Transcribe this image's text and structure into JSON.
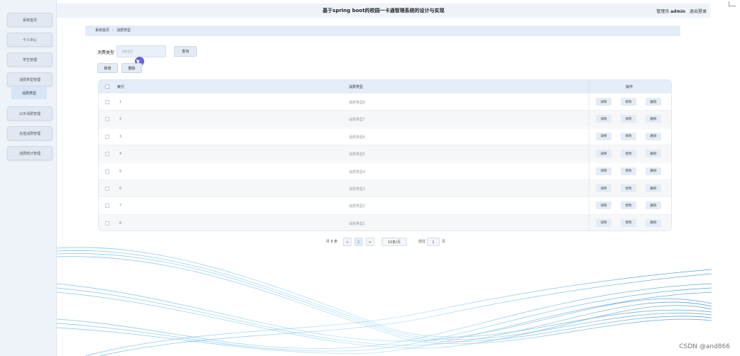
{
  "sidebar": {
    "items": [
      {
        "label": "系统首页"
      },
      {
        "label": "个人中心"
      },
      {
        "label": "学生管理"
      },
      {
        "label": "消费类型管理"
      },
      {
        "label": "公示消费管理"
      },
      {
        "label": "充值消费管理"
      },
      {
        "label": "消费统计管理"
      }
    ],
    "sub_item": "消费类型"
  },
  "header": {
    "title": "基于spring boot的校园一卡通管理系统的设计与实现",
    "role": "管理员",
    "username": "admin",
    "logout": "退出登录"
  },
  "breadcrumb": {
    "home": "系统首页",
    "separator": "›",
    "current": "消费类型"
  },
  "search": {
    "label": "消费类型",
    "placeholder": "消费类型",
    "button": "查询"
  },
  "actions": {
    "add": "新增",
    "delete": "删除"
  },
  "table": {
    "headers": {
      "index": "索引",
      "type": "消费类型",
      "ops": "操作"
    },
    "op_labels": {
      "detail": "详情",
      "edit": "修改",
      "delete": "删除"
    },
    "rows": [
      {
        "idx": "1",
        "type": "消费类型8"
      },
      {
        "idx": "2",
        "type": "消费类型7"
      },
      {
        "idx": "3",
        "type": "消费类型6"
      },
      {
        "idx": "4",
        "type": "消费类型5"
      },
      {
        "idx": "5",
        "type": "消费类型4"
      },
      {
        "idx": "6",
        "type": "消费类型3"
      },
      {
        "idx": "7",
        "type": "消费类型2"
      },
      {
        "idx": "8",
        "type": "消费类型1"
      }
    ]
  },
  "pagination": {
    "total": "共 8 条",
    "prev": "<",
    "page": "1",
    "next": ">",
    "page_size": "10条/页",
    "goto_prefix": "前往",
    "goto_value": "1",
    "goto_suffix": "页"
  },
  "watermark": "CSDN @and866",
  "colors": {
    "accent": "#3a7bd5",
    "sidebar_bg": "#eef3fa",
    "header_row": "#e4edf8",
    "cursor": "#6a63d9"
  }
}
